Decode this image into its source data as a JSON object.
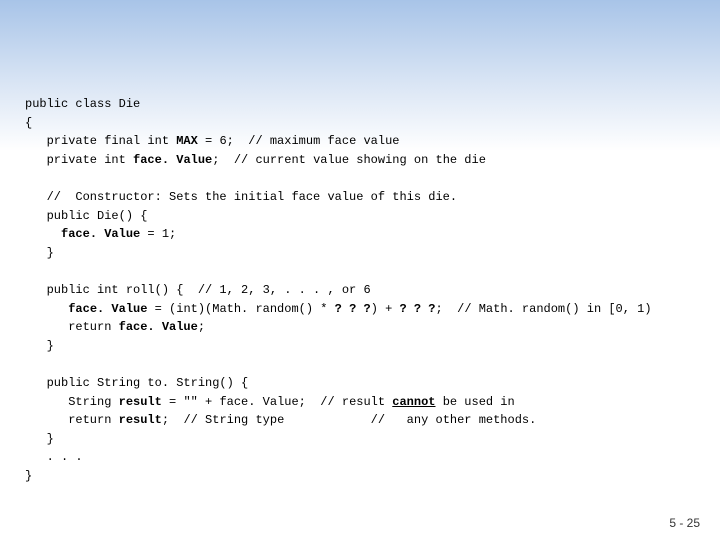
{
  "slide": {
    "page_num": "5 - 25"
  },
  "code": {
    "l1": "public class Die",
    "l2": "{",
    "l3a": "   private final int ",
    "l3_max": "MAX",
    "l3b": " = 6;  // maximum face value",
    "l4a": "   private int ",
    "l4_fv": "face. Value",
    "l4b": ";  // current value showing on the die",
    "blank": " ",
    "l6": "   //  Constructor: Sets the initial face value of this die.",
    "l7": "   public Die() {",
    "l8a": "     ",
    "l8_fv": "face. Value",
    "l8b": " = 1;",
    "l9": "   }",
    "l11": "   public int roll() {  // 1, 2, 3, . . . , or 6",
    "l12a": "      ",
    "l12_fv": "face. Value",
    "l12b": " = (int)(Math. random() * ",
    "l12_q1": "? ? ?",
    "l12c": ") + ",
    "l12_q2": "? ? ?",
    "l12d": ";  // Math. random() in [0, 1)",
    "l13a": "      return ",
    "l13_fv": "face. Value",
    "l13b": ";",
    "l14": "   }",
    "l16": "   public String to. String() {",
    "l17a": "      String ",
    "l17_res": "result",
    "l17b": " = \"\" + face. Value;  // result ",
    "l17_cannot": "cannot",
    "l17c": " be used in",
    "l18a": "      return ",
    "l18_res": "result",
    "l18b": ";  // String type            //   any other methods.",
    "l19": "   }",
    "l20": "   . . .",
    "l21": "}"
  }
}
